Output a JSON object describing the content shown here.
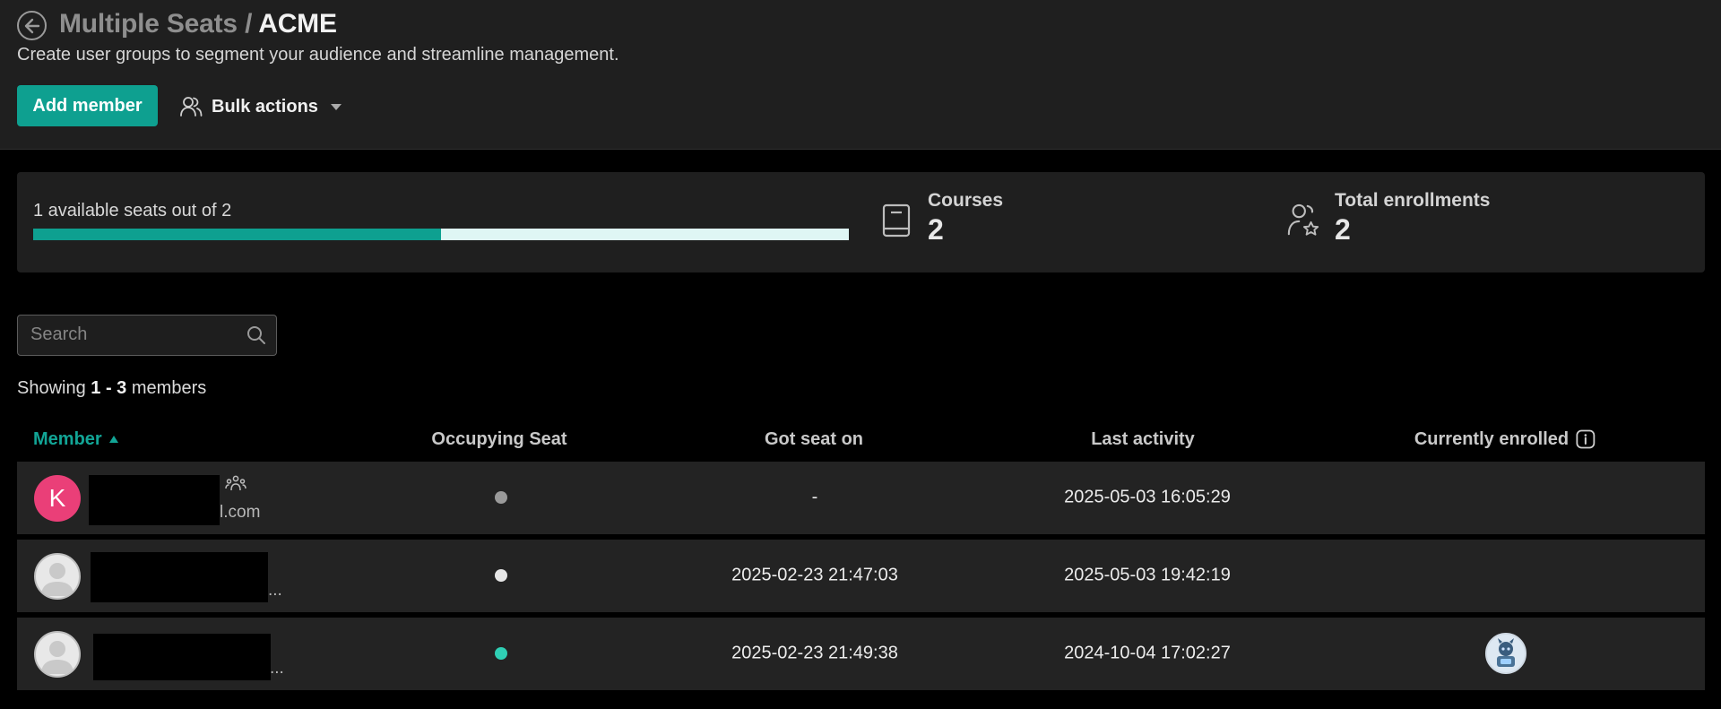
{
  "header": {
    "breadcrumb_parent": "Multiple Seats",
    "breadcrumb_separator": "/",
    "breadcrumb_current": "ACME",
    "subtitle": "Create user groups to segment your audience and streamline management.",
    "add_member_label": "Add member",
    "bulk_actions_label": "Bulk actions"
  },
  "stats": {
    "seats_text": "1 available seats out of 2",
    "seats_used_fraction": 0.5,
    "courses_label": "Courses",
    "courses_value": "2",
    "enrollments_label": "Total enrollments",
    "enrollments_value": "2"
  },
  "search": {
    "placeholder": "Search"
  },
  "listing": {
    "prefix": "Showing",
    "range": "1 - 3",
    "suffix": "members"
  },
  "table": {
    "columns": {
      "member": "Member",
      "occupying_seat": "Occupying Seat",
      "got_seat_on": "Got seat on",
      "last_activity": "Last activity",
      "currently_enrolled": "Currently enrolled"
    },
    "rows": [
      {
        "avatar_initial": "K",
        "email_tail": "l.com",
        "seat_status": "inactive",
        "got_seat_on": "-",
        "last_activity": "2025-05-03 16:05:29",
        "enrolled": ""
      },
      {
        "avatar_initial": "",
        "email_tail": "...",
        "seat_status": "seat",
        "got_seat_on": "2025-02-23 21:47:03",
        "last_activity": "2025-05-03 19:42:19",
        "enrolled": ""
      },
      {
        "avatar_initial": "",
        "email_tail": "...",
        "seat_status": "active",
        "got_seat_on": "2025-02-23 21:49:38",
        "last_activity": "2024-10-04 17:02:27",
        "enrolled": "course-avatar"
      }
    ]
  },
  "colors": {
    "accent": "#0ea090",
    "avatar_k": "#ea3f78",
    "dot_inactive": "#9a9a9a",
    "dot_seat": "#e6e6e6",
    "dot_active": "#2fcfb4"
  }
}
